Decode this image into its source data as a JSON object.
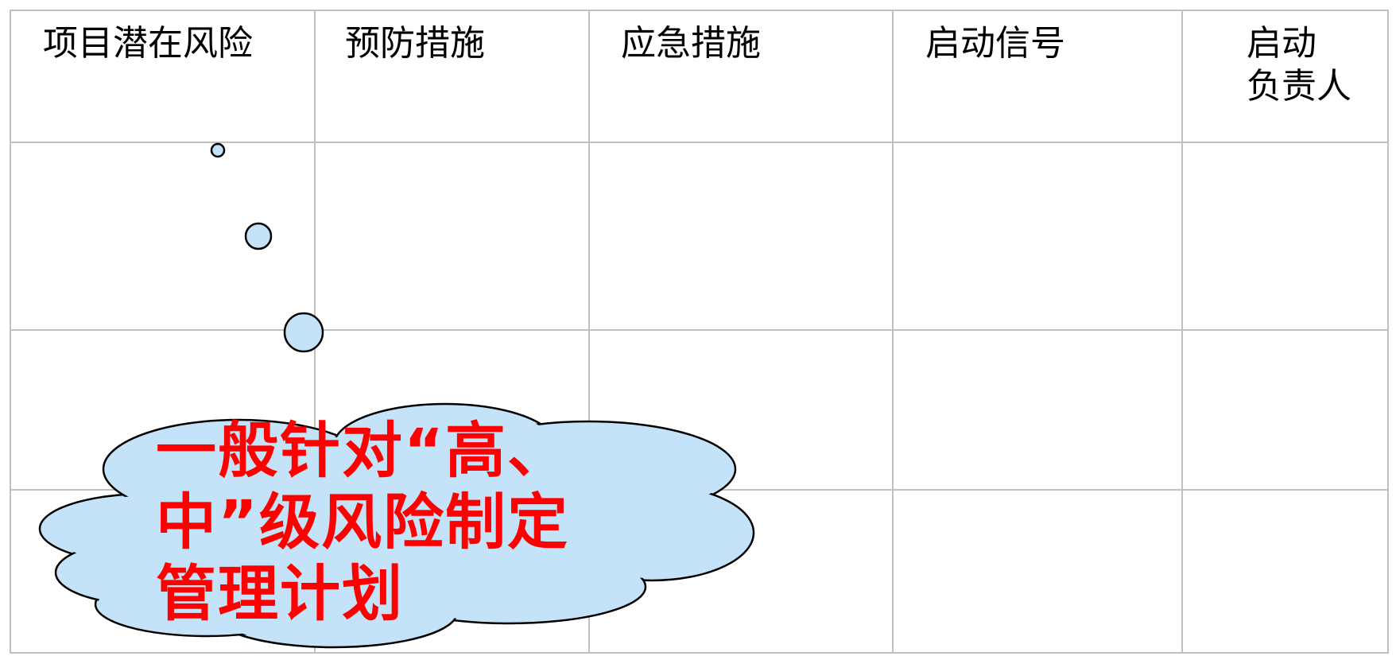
{
  "table": {
    "headers": [
      "项目潜在风险",
      "预防措施",
      "应急措施",
      "启动信号",
      [
        "启动",
        "负责人"
      ]
    ],
    "rows": [
      [
        "",
        "",
        "",
        "",
        ""
      ],
      [
        "",
        "",
        "",
        "",
        ""
      ],
      [
        "",
        "",
        "",
        "",
        ""
      ]
    ]
  },
  "callout": {
    "lines": [
      "一般针对“高、",
      "中”级风险制定",
      "管理计划"
    ],
    "text_color": "#ff0000",
    "fill_color": "#c5e3f8",
    "stroke_color": "#000000"
  },
  "colors": {
    "grid": "#c0c0c0",
    "header_text": "#000000"
  }
}
